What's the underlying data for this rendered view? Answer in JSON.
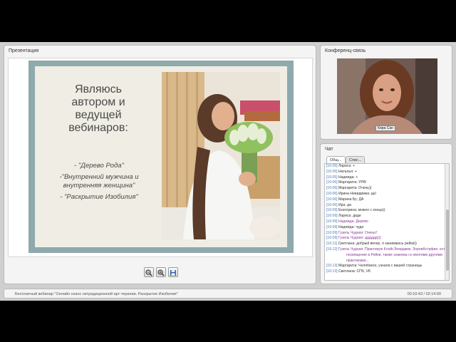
{
  "presentation": {
    "title": "Презентация",
    "slide": {
      "heading": "Являюсь\nавтором и\nведущей\nвебинаров:",
      "bullets": [
        "- \"Дерево Рода\"",
        "-\"Внутренний мужчина и внутренняя женщина\"",
        "- \"Раскрытие Изобилия\""
      ]
    },
    "toolbar_icons": [
      "zoom-out-icon",
      "zoom-in-icon",
      "save-icon"
    ]
  },
  "video": {
    "title": "Конференц-связь",
    "participant_name": "Кира Сан"
  },
  "chat": {
    "title": "Чат",
    "tabs": [
      "Общ...",
      "Спис..."
    ],
    "messages": [
      {
        "time": "[16:05]",
        "author": "Лариса:",
        "text": "+"
      },
      {
        "time": "[16:05]",
        "author": "Наталья:",
        "text": "+"
      },
      {
        "time": "[16:05]",
        "author": "Надежда:",
        "text": "+"
      },
      {
        "time": "[16:06]",
        "author": "Маргарита:",
        "text": "УРА!"
      },
      {
        "time": "[16:06]",
        "author": "Маргарита:",
        "text": "Очень))"
      },
      {
        "time": "[16:06]",
        "author": "Ирина Невидимка:",
        "text": "да!"
      },
      {
        "time": "[16:06]",
        "author": "Марина Бу:",
        "text": "ДА"
      },
      {
        "time": "[16:06]",
        "author": "Ира:",
        "text": "да"
      },
      {
        "time": "[16:09]",
        "author": "Екатерина:",
        "text": "можно с конца))"
      },
      {
        "time": "[16:09]",
        "author": "Лариса:",
        "text": "даде"
      },
      {
        "time": "[16:09]",
        "author": "Надежда:",
        "text": "Дерево"
      },
      {
        "time": "[16:09]",
        "author": "Надежда:",
        "text": "чуда"
      },
      {
        "time": "[16:09]",
        "author": "Гузель Чудная:",
        "text": "Очень!!"
      },
      {
        "time": "[16:09]",
        "author": "Гузель Чудная:",
        "text": "дддддд)))"
      },
      {
        "time": "[16:11]",
        "author": "Светлана:",
        "text": "добрый вечер, я занимаюсь рейки))"
      },
      {
        "time": "[16:12]",
        "author": "Гузель Чудная:",
        "text": "Практикую КлэйсЭнерджик, ЗоровАстрфин, есть посвящение в Рейки, также знакома со многими другими практиками..."
      },
      {
        "time": "[16:13]",
        "author": "Маргарита:",
        "text": "Челябинск, узнала с вашей страницы"
      },
      {
        "time": "[16:13]",
        "author": "Светлана:",
        "text": "СПб, VK"
      }
    ]
  },
  "status": {
    "title": "Бесплатный вебинар \"Онлайн сеанс нетрадиционной арт-терапии. Раскрытие Изобилия\"",
    "time": "00:10:43 / 02:14:00"
  },
  "colors": {
    "frame_bg": "#cfcfcf",
    "panel_bg": "#f4f4f4",
    "slide_border": "#8fa9ad",
    "chat_time": "#4a7bb7",
    "chat_highlight": "#8b3a9a"
  }
}
